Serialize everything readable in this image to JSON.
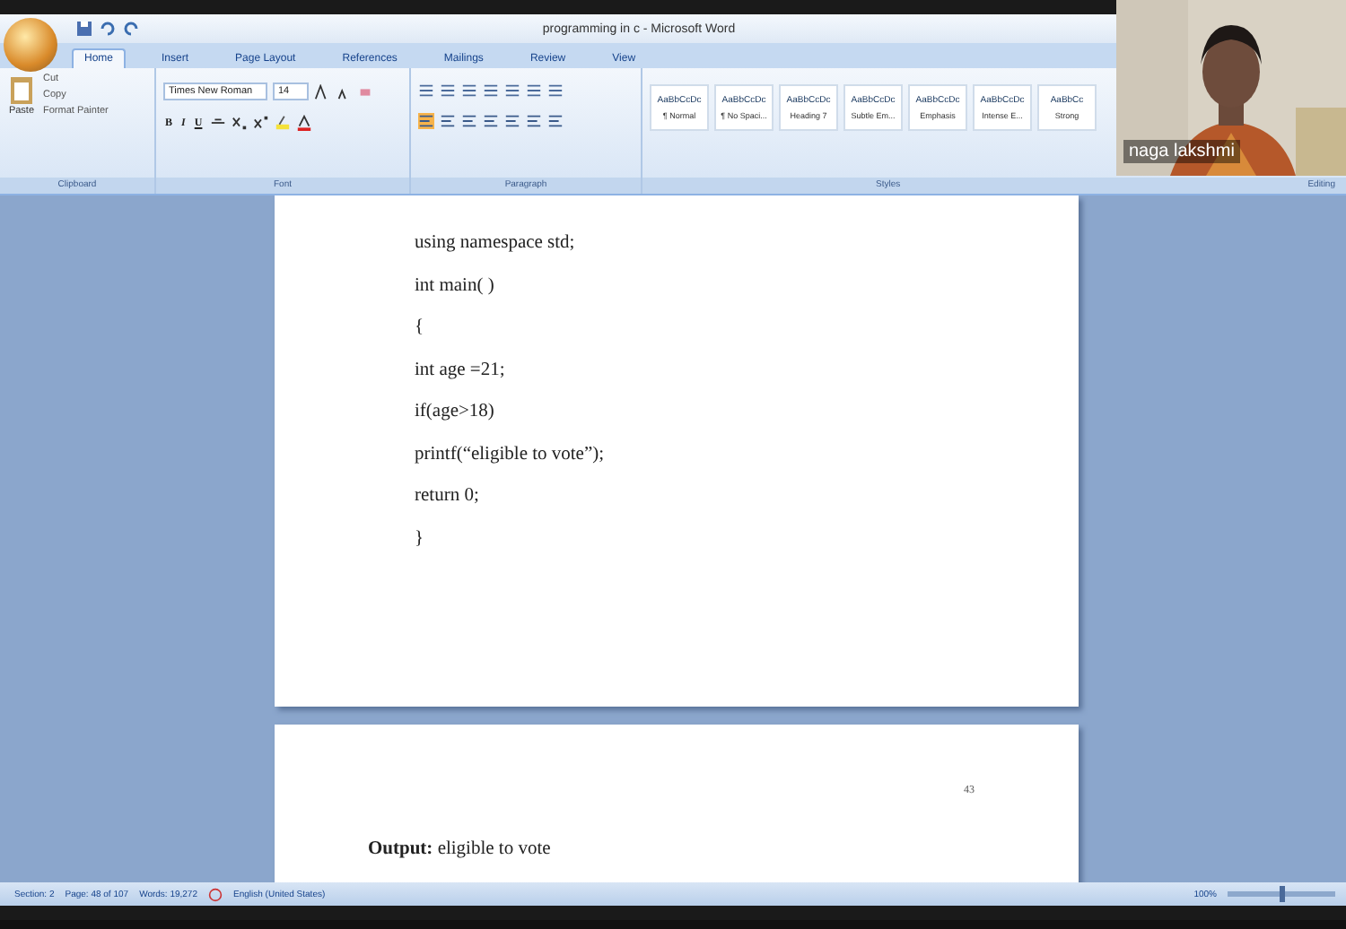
{
  "window": {
    "title": "programming in c - Microsoft Word"
  },
  "tabs": [
    {
      "label": "Home",
      "selected": true
    },
    {
      "label": "Insert",
      "selected": false
    },
    {
      "label": "Page Layout",
      "selected": false
    },
    {
      "label": "References",
      "selected": false
    },
    {
      "label": "Mailings",
      "selected": false
    },
    {
      "label": "Review",
      "selected": false
    },
    {
      "label": "View",
      "selected": false
    }
  ],
  "ribbon": {
    "clipboard": {
      "paste": "Paste",
      "cut": "Cut",
      "copy": "Copy",
      "format_painter": "Format Painter",
      "label": "Clipboard"
    },
    "font": {
      "family": "Times New Roman",
      "size": "14",
      "bold": "B",
      "italic": "I",
      "underline": "U",
      "label": "Font"
    },
    "paragraph": {
      "label": "Paragraph"
    },
    "styles": [
      {
        "preview": "AaBbCcDc",
        "name": "¶ Normal"
      },
      {
        "preview": "AaBbCcDc",
        "name": "¶ No Spaci..."
      },
      {
        "preview": "AaBbCcDc",
        "name": "Heading 7"
      },
      {
        "preview": "AaBbCcDc",
        "name": "Subtle Em..."
      },
      {
        "preview": "AaBbCcDc",
        "name": "Emphasis"
      },
      {
        "preview": "AaBbCcDc",
        "name": "Intense E..."
      },
      {
        "preview": "AaBbCc",
        "name": "Strong"
      }
    ],
    "styles_label": "Styles",
    "editing_label": "Editing"
  },
  "document": {
    "page1_lines": [
      "using namespace std;",
      "int main( )",
      "{",
      "int age =21;",
      "if(age>18)",
      "printf(“eligible to vote”);",
      "return 0;",
      "}"
    ],
    "page_number": "43",
    "output_line": "**Output:** eligible to vote"
  },
  "status_bar": {
    "section": "Section: 2",
    "page": "Page: 48 of 107",
    "words": "Words: 19,272",
    "language": "English (United States)",
    "zoom": "100%",
    "zoom_slider": {
      "level": 0.5
    }
  },
  "video": {
    "participant": "naga lakshmi"
  }
}
